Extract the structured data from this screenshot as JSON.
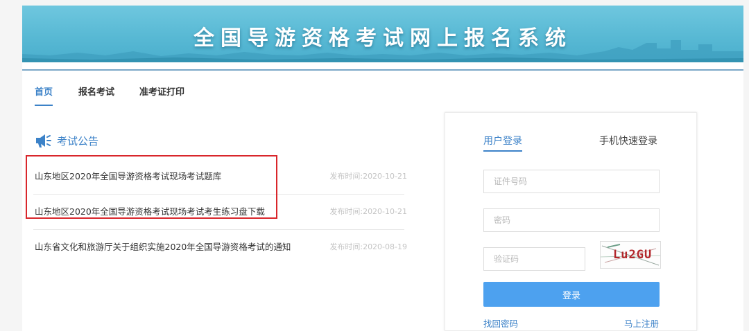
{
  "banner": {
    "title": "全国导游资格考试网上报名系统"
  },
  "nav": {
    "items": [
      {
        "label": "首页",
        "active": true
      },
      {
        "label": "报名考试",
        "active": false
      },
      {
        "label": "准考证打印",
        "active": false
      }
    ]
  },
  "notices": {
    "heading": "考试公告",
    "icon": "megaphone-icon",
    "items": [
      {
        "title": "山东地区2020年全国导游资格考试现场考试题库",
        "date": "发布时间:2020-10-21"
      },
      {
        "title": "山东地区2020年全国导游资格考试现场考试考生练习盘下载",
        "date": "发布时间:2020-10-21"
      },
      {
        "title": "山东省文化和旅游厅关于组织实施2020年全国导游资格考试的通知",
        "date": "发布时间:2020-08-19"
      }
    ]
  },
  "login": {
    "tabs": [
      {
        "label": "用户登录",
        "active": true
      },
      {
        "label": "手机快速登录",
        "active": false
      }
    ],
    "id_placeholder": "证件号码",
    "password_placeholder": "密码",
    "captcha_placeholder": "验证码",
    "captcha_text": "Lu2GU",
    "submit_label": "登录",
    "forgot_label": "找回密码",
    "register_label": "马上注册"
  },
  "colors": {
    "accent": "#3c82c8",
    "button": "#4da1ef",
    "highlight": "#d9262b",
    "banner": "#5bbcd6"
  }
}
